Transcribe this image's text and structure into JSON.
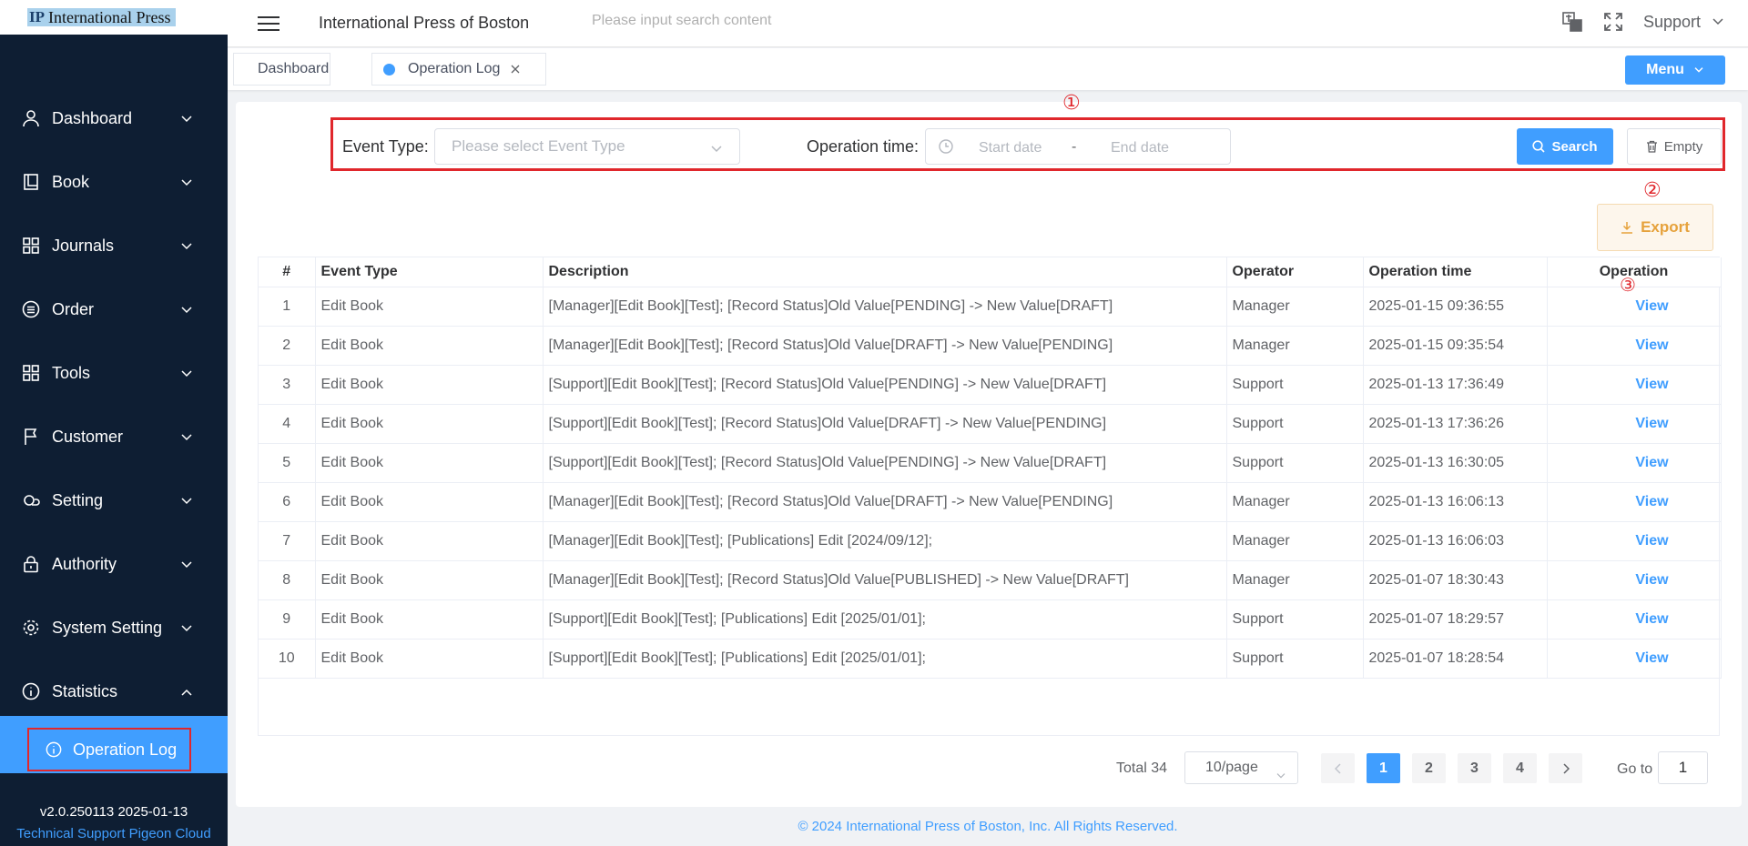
{
  "logo": {
    "mark": "IP",
    "text": "International Press"
  },
  "sidebar": {
    "items": [
      {
        "label": "Dashboard",
        "icon": "user-icon",
        "expanded": false
      },
      {
        "label": "Book",
        "icon": "book-icon",
        "expanded": false
      },
      {
        "label": "Journals",
        "icon": "grid-icon",
        "expanded": false
      },
      {
        "label": "Order",
        "icon": "list-circle-icon",
        "expanded": false
      },
      {
        "label": "Tools",
        "icon": "grid-icon",
        "expanded": false
      },
      {
        "label": "Customer",
        "icon": "flag-icon",
        "expanded": false
      },
      {
        "label": "Setting",
        "icon": "cloud-icon",
        "expanded": false
      },
      {
        "label": "Authority",
        "icon": "lock-icon",
        "expanded": false
      },
      {
        "label": "System Setting",
        "icon": "gear-icon",
        "expanded": false
      },
      {
        "label": "Statistics",
        "icon": "info-icon",
        "expanded": true
      }
    ],
    "active_sub": "Operation Log",
    "version": "v2.0.250113 2025-01-13",
    "support": "Technical Support Pigeon Cloud"
  },
  "header": {
    "title": "International Press of Boston",
    "search_placeholder": "Please input search content",
    "user": "Support"
  },
  "tabs": [
    {
      "label": "Dashboard",
      "active": false
    },
    {
      "label": "Operation Log",
      "active": true
    }
  ],
  "menu_button": "Menu",
  "filter": {
    "event_type_label": "Event Type:",
    "event_type_placeholder": "Please select Event Type",
    "op_time_label": "Operation time:",
    "start_placeholder": "Start date",
    "separator": "-",
    "end_placeholder": "End date",
    "search_label": "Search",
    "empty_label": "Empty"
  },
  "markers": {
    "one": "①",
    "two": "②",
    "three": "③"
  },
  "export_label": "Export",
  "table": {
    "headers": [
      "#",
      "Event Type",
      "Description",
      "Operator",
      "Operation time",
      "Operation"
    ],
    "rows": [
      {
        "n": "1",
        "type": "Edit Book",
        "desc": "[Manager][Edit Book][Test]; [Record Status]Old Value[PENDING] -> New Value[DRAFT]",
        "op": "Manager",
        "time": "2025-01-15 09:36:55",
        "action": "View"
      },
      {
        "n": "2",
        "type": "Edit Book",
        "desc": "[Manager][Edit Book][Test]; [Record Status]Old Value[DRAFT] -> New Value[PENDING]",
        "op": "Manager",
        "time": "2025-01-15 09:35:54",
        "action": "View"
      },
      {
        "n": "3",
        "type": "Edit Book",
        "desc": "[Support][Edit Book][Test]; [Record Status]Old Value[PENDING] -> New Value[DRAFT]",
        "op": "Support",
        "time": "2025-01-13 17:36:49",
        "action": "View"
      },
      {
        "n": "4",
        "type": "Edit Book",
        "desc": "[Support][Edit Book][Test]; [Record Status]Old Value[DRAFT] -> New Value[PENDING]",
        "op": "Support",
        "time": "2025-01-13 17:36:26",
        "action": "View"
      },
      {
        "n": "5",
        "type": "Edit Book",
        "desc": "[Support][Edit Book][Test]; [Record Status]Old Value[PENDING] -> New Value[DRAFT]",
        "op": "Support",
        "time": "2025-01-13 16:30:05",
        "action": "View"
      },
      {
        "n": "6",
        "type": "Edit Book",
        "desc": "[Manager][Edit Book][Test]; [Record Status]Old Value[DRAFT] -> New Value[PENDING]",
        "op": "Manager",
        "time": "2025-01-13 16:06:13",
        "action": "View"
      },
      {
        "n": "7",
        "type": "Edit Book",
        "desc": "[Manager][Edit Book][Test]; [Publications] Edit [2024/09/12];",
        "op": "Manager",
        "time": "2025-01-13 16:06:03",
        "action": "View"
      },
      {
        "n": "8",
        "type": "Edit Book",
        "desc": "[Manager][Edit Book][Test]; [Record Status]Old Value[PUBLISHED] -> New Value[DRAFT]",
        "op": "Manager",
        "time": "2025-01-07 18:30:43",
        "action": "View"
      },
      {
        "n": "9",
        "type": "Edit Book",
        "desc": "[Support][Edit Book][Test]; [Publications] Edit [2025/01/01];",
        "op": "Support",
        "time": "2025-01-07 18:29:57",
        "action": "View"
      },
      {
        "n": "10",
        "type": "Edit Book",
        "desc": "[Support][Edit Book][Test]; [Publications] Edit [2025/01/01];",
        "op": "Support",
        "time": "2025-01-07 18:28:54",
        "action": "View"
      }
    ]
  },
  "pagination": {
    "total": "Total 34",
    "page_size": "10/page",
    "pages": [
      "1",
      "2",
      "3",
      "4"
    ],
    "current": "1",
    "goto_label": "Go to",
    "goto_value": "1"
  },
  "footer": "© 2024 International Press of Boston, Inc. All Rights Reserved.",
  "colors": {
    "primary": "#409eff",
    "sidebar": "#0e1e33",
    "annotation": "#e0272c",
    "warning": "#e6a23c"
  }
}
